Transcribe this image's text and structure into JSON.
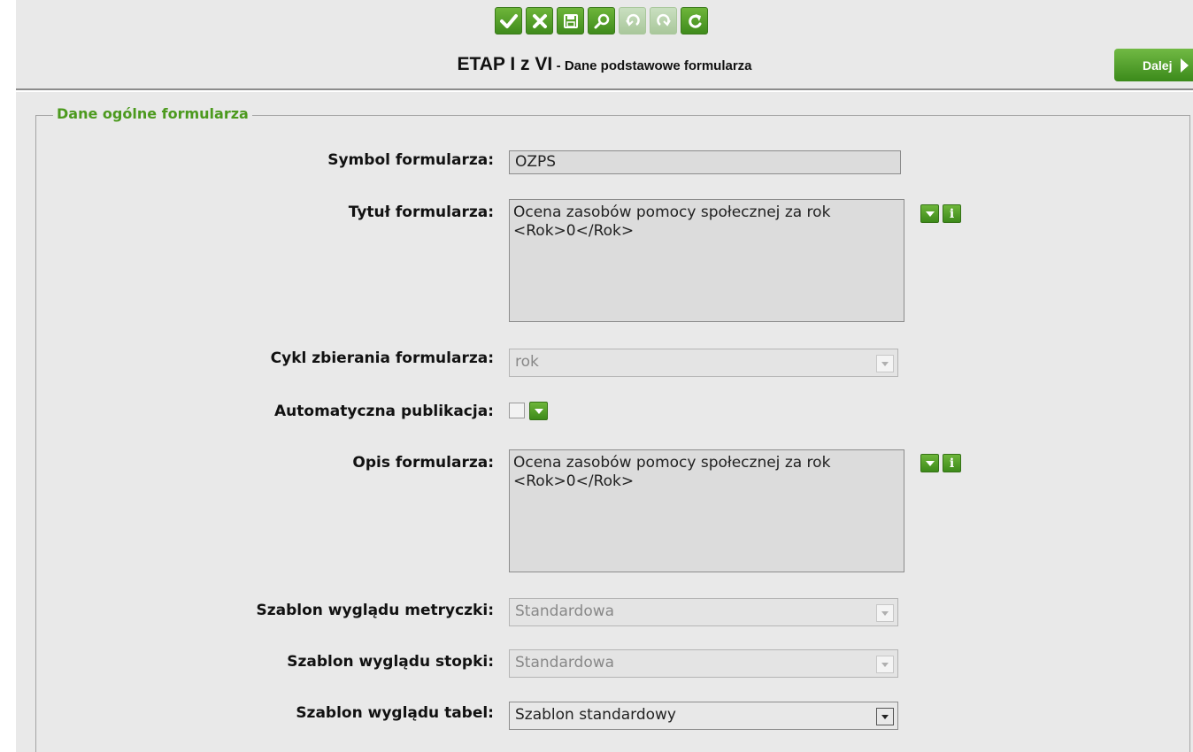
{
  "toolbar": {
    "buttons": [
      {
        "icon": "check-icon",
        "enabled": true
      },
      {
        "icon": "close-icon",
        "enabled": true
      },
      {
        "icon": "save-icon",
        "enabled": true
      },
      {
        "icon": "search-icon",
        "enabled": true
      },
      {
        "icon": "undo-icon",
        "enabled": false
      },
      {
        "icon": "redo-icon",
        "enabled": false
      },
      {
        "icon": "refresh-icon",
        "enabled": true
      }
    ]
  },
  "header": {
    "stage": "ETAP I z VI",
    "subtitle": "- Dane podstawowe formularza",
    "next_label": "Dalej"
  },
  "form": {
    "legend": "Dane ogólne formularza",
    "symbol": {
      "label": "Symbol formularza:",
      "value": "OZPS"
    },
    "title": {
      "label": "Tytuł formularza:",
      "value": "Ocena zasobów pomocy społecznej za rok <Rok>0</Rok>"
    },
    "cycle": {
      "label": "Cykl zbierania formularza:",
      "value": "rok"
    },
    "auto_publish": {
      "label": "Automatyczna publikacja:",
      "checked": false
    },
    "description": {
      "label": "Opis formularza:",
      "value": "Ocena zasobów pomocy społecznej za rok <Rok>0</Rok>"
    },
    "metric_template": {
      "label": "Szablon wyglądu metryczki:",
      "value": "Standardowa"
    },
    "footer_template": {
      "label": "Szablon wyglądu stopki:",
      "value": "Standardowa"
    },
    "table_template": {
      "label": "Szablon wyglądu tabel:",
      "value": "Szablon standardowy"
    }
  },
  "colors": {
    "accent": "#4c9a1e",
    "panel": "#e9e9e9"
  }
}
